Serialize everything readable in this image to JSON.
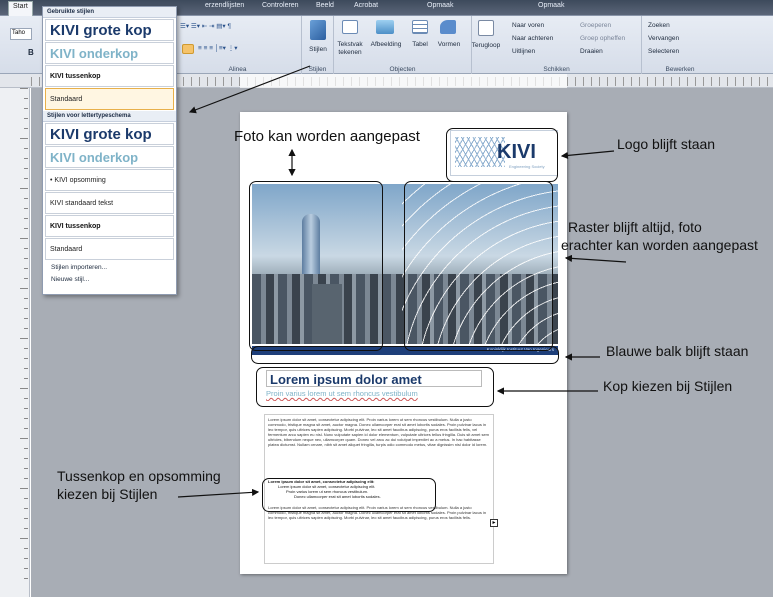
{
  "ribbon": {
    "tabs": [
      "Start",
      "Gebruikte stijlen",
      "erzendlijsten",
      "Controleren",
      "Beeld",
      "Acrobat",
      "Opmaak",
      "Opmaak"
    ],
    "font_box": "Taho",
    "bold_label": "B",
    "groups": {
      "alinea": "Alinea",
      "stijlen": "Stijlen",
      "objecten": "Objecten",
      "schikken": "Schikken",
      "bewerken": "Bewerken"
    },
    "buttons": {
      "stijlen": "Stijlen",
      "tekstvak": "Tekstvak",
      "tekenen": "tekenen",
      "afbeelding": "Afbeelding",
      "tabel": "Tabel",
      "vormen": "Vormen",
      "terugloop": "Terugloop",
      "naar_voren": "Naar voren",
      "naar_achteren": "Naar achteren",
      "uitlijnen": "Uitlijnen",
      "groeperen": "Groeperen",
      "groep_opheffen": "Groep opheffen",
      "draaien": "Draaien",
      "zoeken": "Zoeken",
      "vervangen": "Vervangen",
      "selecteren": "Selecteren"
    }
  },
  "styles_menu": {
    "used_header": "Gebruikte stijlen",
    "used": [
      {
        "label": "KIVI grote kop",
        "kind": "big"
      },
      {
        "label": "KIVI onderkop",
        "kind": "big2"
      },
      {
        "label": "KIVI tussenkop",
        "kind": "smallb"
      },
      {
        "label": "Standaard",
        "kind": "small"
      }
    ],
    "scheme_header": "Stijlen voor lettertypeschema",
    "scheme": [
      {
        "label": "KIVI grote kop",
        "kind": "big"
      },
      {
        "label": "KIVI onderkop",
        "kind": "big2"
      },
      {
        "label": "•   KIVI opsomming",
        "kind": "small"
      },
      {
        "label": "KIVI standaard tekst",
        "kind": "small"
      },
      {
        "label": "KIVI tussenkop",
        "kind": "smallb"
      },
      {
        "label": "Standaard",
        "kind": "small"
      }
    ],
    "import_link": "Stijlen importeren...",
    "new_link": "Nieuwe stijl..."
  },
  "document": {
    "logo_text": "KIVI",
    "logo_sub": "Engineering Society",
    "bar_text": "Koninklijk Instituut Van Ingenieurs",
    "heading": "Lorem ipsum dolor amet",
    "subheading": "Proin varius lorem ut sem rhoncus vestibulum",
    "body1": "Lorem ipsum dolor sit amet, consectetur adipiscing elit. Proin varius lorem ut sem rhoncus vestibulum. Nulla a justo commodo, tristique magna sit amet, auctor magna. Donec ullamcorper erat sit amet lobortis sodales. Proin pulvinar lacus in leo tempor, quis ultrices sapien adipiscing. Morbi pulvinar, leo sit amet faucibus adipiscing, purus eros facilisis felis, vel fermentum arcu sapien eu nisl. Nunc vulputate sapien id dolor elementum, vulputate ultrices tellus fringilla. Duis sit amet sem ultricies, bibendum neque nec, ullamcorper quam. Donec vel arcu ac dui volutpat imperdiet ac a metus. In hac habitasse platea dictumst. Nullam ornare, nibh sit amet aliquet fringilla, turpis odio commodo metus, vitae dignissim nisl dolor id lorem.",
    "list_title": "Lorem ipsum dolor sit amet, consectetur adipiscing elit:",
    "list": [
      "Lorem ipsum dolor sit amet, consectetur adipiscing elit.",
      "Proin varius lorem ut sem rhoncus vestibulum.",
      "Donec ullamcorper erat sit amet lobortis sodales."
    ],
    "body2": "Lorem ipsum dolor sit amet, consectetur adipiscing elit. Proin varius lorem ut sem rhoncus vestibulum. Nulla a justo commodo, tristique magna sit amet, auctor magna. Donec ullamcorper erat sit amet lobortis sodales. Proin pulvinar lacus in leo tempor, quis ultrices sapien adipiscing. Morbi pulvinar, leo sit amet faucibus adipiscing, purus eros facilisis felis."
  },
  "annotations": {
    "foto": "Foto kan worden aangepast",
    "logo": "Logo blijft staan",
    "raster1": "Raster blijft altijd, foto",
    "raster2": "erachter kan worden aangepast",
    "blauw": "Blauwe balk blijft staan",
    "kop": "Kop kiezen bij Stijlen",
    "tussen1": "Tussenkop en opsomming",
    "tussen2": "kiezen bij Stijlen"
  },
  "colors": {
    "kivi_blue": "#1b3a6b",
    "kivi_light": "#7fb3c8",
    "bar_blue": "#1e3f7a"
  }
}
